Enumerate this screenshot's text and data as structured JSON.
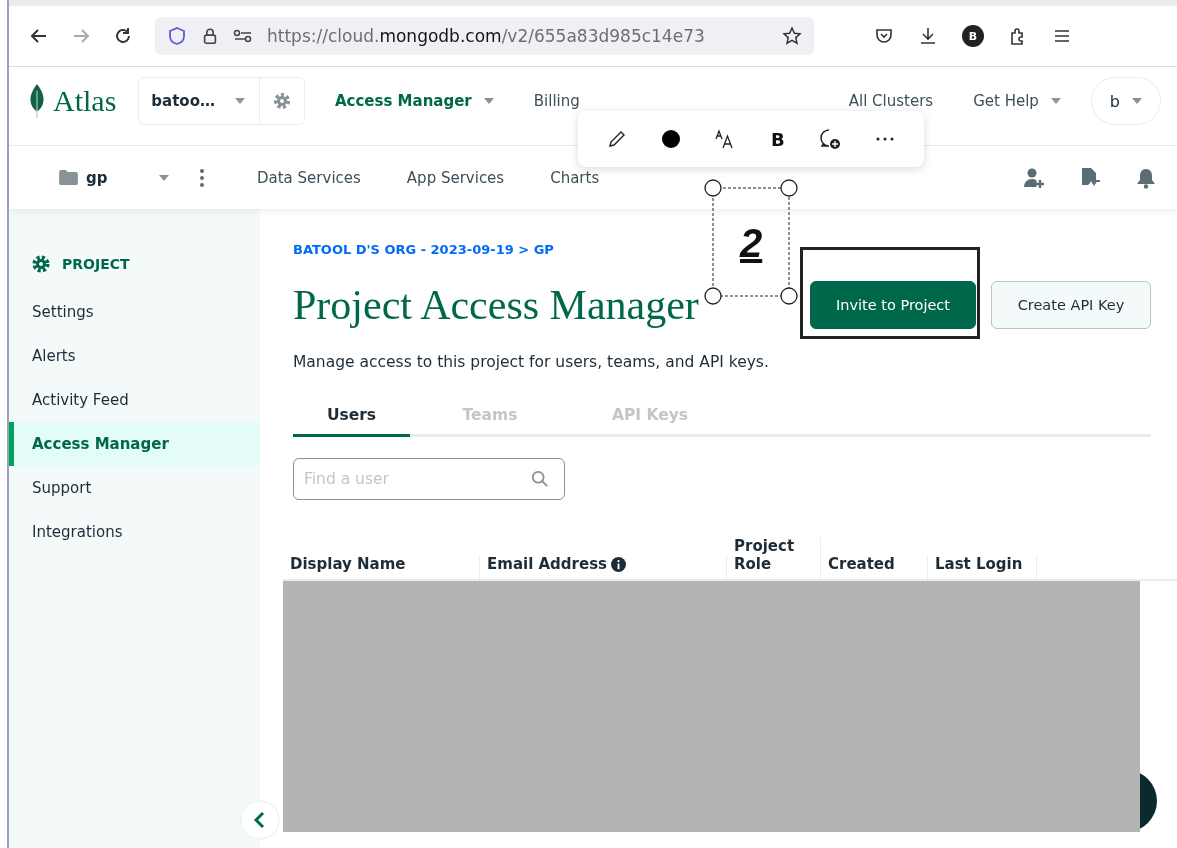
{
  "browser": {
    "url": "https://cloud.**mongodb.com**/v2/655a83d985c14e73",
    "profile": "B"
  },
  "header": {
    "logo": "Atlas",
    "org": "batoo…",
    "nav": [
      {
        "label": "Access Manager",
        "selected": true,
        "dropdown": true
      },
      {
        "label": "Billing",
        "selected": false,
        "dropdown": false
      }
    ],
    "right": [
      {
        "label": "All Clusters",
        "dropdown": false
      },
      {
        "label": "Get Help",
        "dropdown": true
      }
    ],
    "user": "b"
  },
  "subnav": {
    "project": "gp",
    "tabs": [
      {
        "label": "Data Services"
      },
      {
        "label": "App Services"
      },
      {
        "label": "Charts"
      }
    ]
  },
  "sidebar": {
    "section": "PROJECT",
    "items": [
      {
        "label": "Settings",
        "selected": false
      },
      {
        "label": "Alerts",
        "selected": false
      },
      {
        "label": "Activity Feed",
        "selected": false
      },
      {
        "label": "Access Manager",
        "selected": true
      },
      {
        "label": "Support",
        "selected": false
      },
      {
        "label": "Integrations",
        "selected": false
      }
    ]
  },
  "breadcrumb": "BATOOL D'S ORG - 2023-09-19 > GP",
  "title": "Project Access Manager",
  "description": "Manage access to this project for users, teams, and API keys.",
  "buttons": [
    {
      "label": "Invite to Project",
      "kind": "primary"
    },
    {
      "label": "Create API Key",
      "kind": "secondary"
    }
  ],
  "tabs": [
    {
      "label": "Users",
      "selected": true
    },
    {
      "label": "Teams",
      "selected": false
    },
    {
      "label": "API Keys",
      "selected": false
    }
  ],
  "search": {
    "placeholder": "Find a user"
  },
  "table": {
    "columns": [
      {
        "label": "Display Name",
        "info": false
      },
      {
        "label": "Email Address",
        "info": true
      },
      {
        "label": "Project Role",
        "info": false
      },
      {
        "label": "Created",
        "info": false
      },
      {
        "label": "Last Login",
        "info": false
      }
    ],
    "redacted": true
  },
  "annotation": {
    "label": "2",
    "tools": [
      {
        "kind": "pen"
      },
      {
        "kind": "color",
        "color": "#000000"
      },
      {
        "kind": "text-size"
      },
      {
        "kind": "bold",
        "label": "B"
      },
      {
        "kind": "comment"
      },
      {
        "kind": "more"
      }
    ]
  }
}
